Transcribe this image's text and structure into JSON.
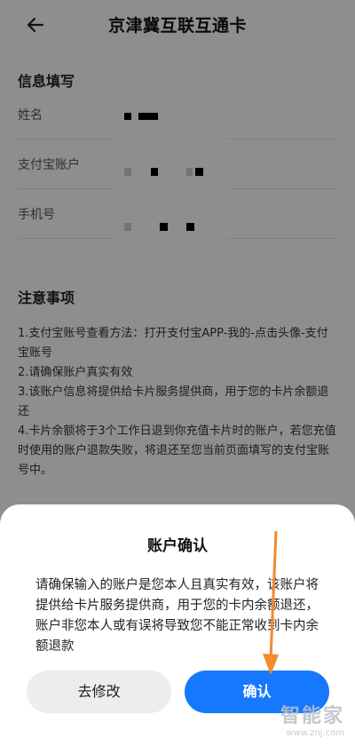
{
  "header": {
    "title": "京津冀互联互通卡",
    "back_icon": "arrow-left-icon"
  },
  "form": {
    "section_title": "信息填写",
    "fields": [
      {
        "label": "姓名"
      },
      {
        "label": "支付宝账户"
      },
      {
        "label": "手机号"
      }
    ]
  },
  "notes": {
    "title": "注意事项",
    "items": [
      "1.支付宝账号查看方法：打开支付宝APP-我的-点击头像-支付宝账号",
      "2.请确保账户真实有效",
      "3.该账户信息将提供给卡片服务提供商，用于您的卡片余额退还",
      "4.卡片余额将于3个工作日退到你充值卡片时的账户，若您充值时使用的账户退款失败，将退还至您当前页面填写的支付宝账号中。"
    ]
  },
  "dialog": {
    "title": "账户确认",
    "message": "请确保输入的账户是您本人且真实有效，该账户将提供给卡片服务提供商，用于您的卡内余额退还，账户非您本人或有误将导致您不能正常收到卡内余额退款",
    "cancel_label": "去修改",
    "confirm_label": "确认"
  },
  "colors": {
    "primary": "#1677ff",
    "arrow": "#f28a2e"
  },
  "watermark": {
    "logo": "智能家",
    "url": "www.znj.com"
  }
}
